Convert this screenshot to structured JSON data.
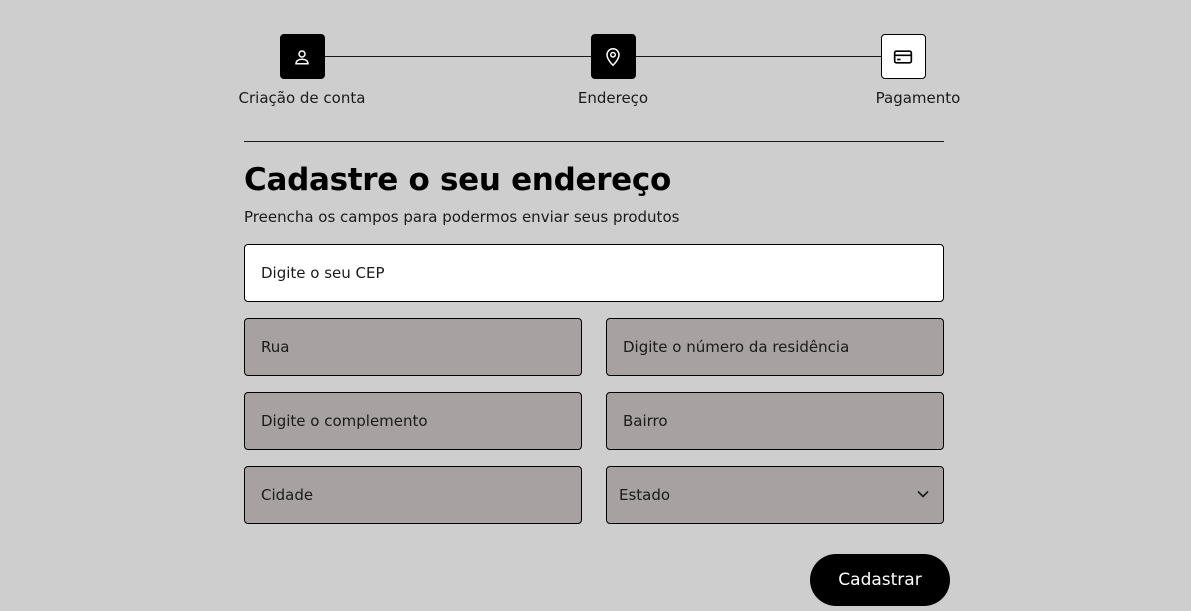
{
  "stepper": {
    "steps": [
      {
        "label": "Criação de conta",
        "icon": "user-icon",
        "state": "done"
      },
      {
        "label": "Endereço",
        "icon": "map-pin-icon",
        "state": "active"
      },
      {
        "label": "Pagamento",
        "icon": "credit-card-icon",
        "state": "pending"
      }
    ]
  },
  "header": {
    "title": "Cadastre o seu endereço",
    "subtitle": "Preencha os campos para podermos enviar seus produtos"
  },
  "form": {
    "cep": {
      "placeholder": "Digite o seu CEP",
      "value": ""
    },
    "rua": {
      "placeholder": "Rua",
      "value": ""
    },
    "numero": {
      "placeholder": "Digite o número da residência",
      "value": ""
    },
    "complemento": {
      "placeholder": "Digite o complemento",
      "value": ""
    },
    "bairro": {
      "placeholder": "Bairro",
      "value": ""
    },
    "cidade": {
      "placeholder": "Cidade",
      "value": ""
    },
    "estado": {
      "selected": "Estado"
    },
    "submit_label": "Cadastrar"
  },
  "colors": {
    "background": "#cecece",
    "field_disabled": "#a7a1a1",
    "field_active": "#ffffff",
    "accent": "#000000"
  }
}
